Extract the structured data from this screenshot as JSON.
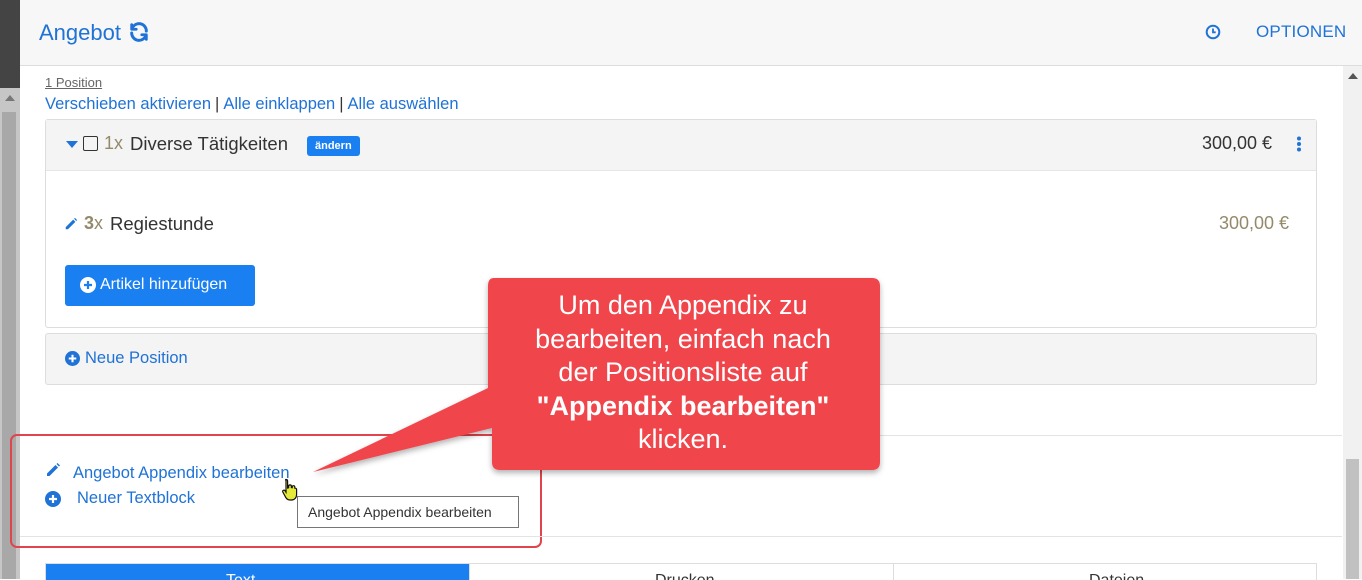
{
  "header": {
    "title": "Angebot",
    "options_label": "OPTIONEN"
  },
  "positions": {
    "count_label": "1 Position",
    "links": [
      "Verschieben aktivieren",
      "Alle einklappen",
      "Alle auswählen"
    ],
    "separator": "|"
  },
  "group": {
    "qty": "1x",
    "name": "Diverse Tätigkeiten",
    "badge": "ändern",
    "price": "300,00 €",
    "items": [
      {
        "qty_num": "3",
        "qty_unit": "x",
        "name": "Regiestunde",
        "price": "300,00 €"
      }
    ],
    "add_article_label": "Artikel hinzufügen"
  },
  "new_position_label": "Neue Position",
  "appendix": {
    "edit_label": "Angebot Appendix bearbeiten",
    "new_textblock_label": "Neuer Textblock",
    "tooltip": "Angebot Appendix bearbeiten"
  },
  "callout": {
    "line1": "Um den Appendix zu",
    "line2": "bearbeiten, einfach nach",
    "line3": "der Positionsliste auf",
    "line4": "\"Appendix bearbeiten\"",
    "line5": "klicken."
  },
  "tabs": [
    "Text",
    "Drucken",
    "Dateien"
  ],
  "colors": {
    "accent": "#1a7ff0",
    "callout": "#f0454b",
    "link": "#1f72d6"
  }
}
